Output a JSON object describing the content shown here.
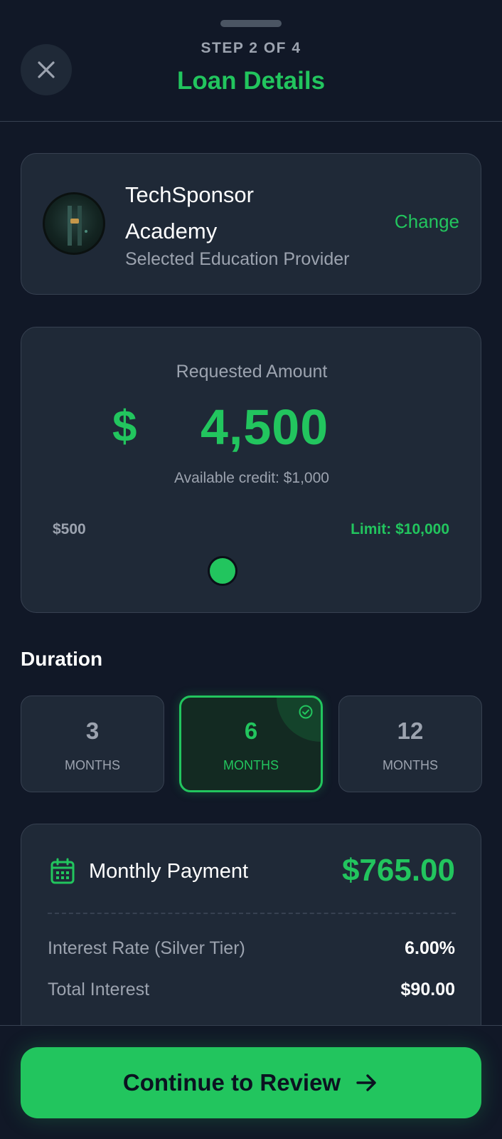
{
  "header": {
    "step": "STEP 2 OF 4",
    "title": "Loan Details"
  },
  "provider": {
    "name": "TechSponsor Academy",
    "subtitle": "Selected Education Provider",
    "change_label": "Change"
  },
  "amount": {
    "label": "Requested Amount",
    "currency": "$",
    "value": "4,500",
    "available_credit": "Available credit: $1,000",
    "min_label": "$500",
    "max_label": "Limit: $10,000",
    "slider_fraction": 0.42
  },
  "duration": {
    "title": "Duration",
    "options": [
      {
        "number": "3",
        "unit": "MONTHS",
        "selected": false
      },
      {
        "number": "6",
        "unit": "MONTHS",
        "selected": true
      },
      {
        "number": "12",
        "unit": "MONTHS",
        "selected": false
      }
    ]
  },
  "payment": {
    "monthly_label": "Monthly Payment",
    "monthly_value": "$765.00",
    "rows": [
      {
        "label": "Interest Rate (Silver Tier)",
        "value": "6.00%"
      },
      {
        "label": "Total Interest",
        "value": "$90.00"
      }
    ]
  },
  "cta": {
    "label": "Continue to Review"
  },
  "colors": {
    "accent": "#22c55e",
    "background": "#111827",
    "card": "#1f2937"
  },
  "icons": {
    "close": "close-icon",
    "check": "check-circle-icon",
    "calendar": "calendar-icon",
    "arrow": "arrow-right-icon"
  }
}
